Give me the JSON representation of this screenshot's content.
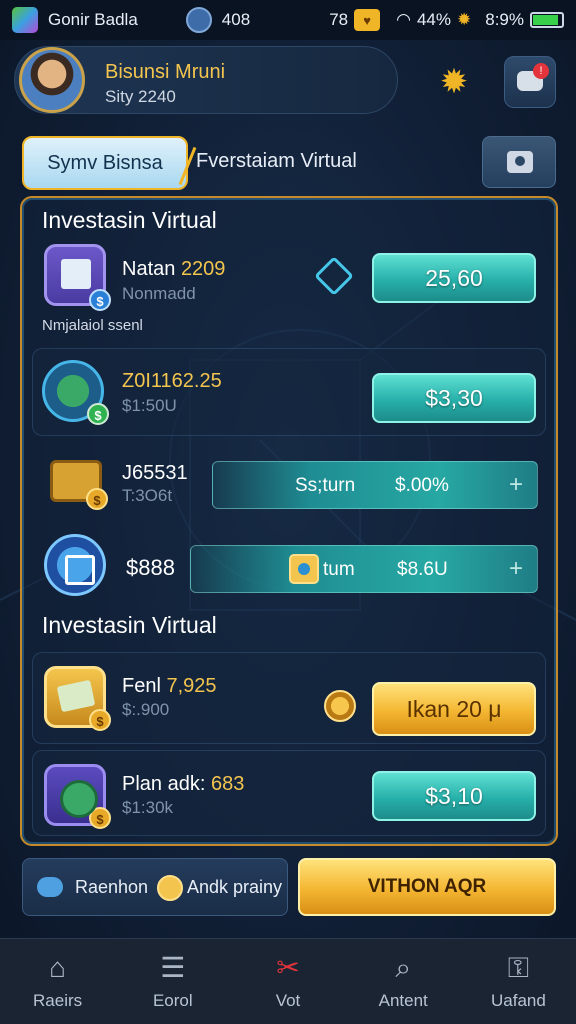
{
  "status_bar": {
    "app_name": "Gonir Badla",
    "counter": "408",
    "coins": "78",
    "wifi_battery": "44%",
    "battery_percent": "8:9%",
    "battery_level": 0.9
  },
  "profile": {
    "name": "Bisunsi Mruni",
    "city_line": "Sity 2240"
  },
  "tabs": {
    "active": "Symv Bisnsa",
    "second": "Fverstaiam Virtual"
  },
  "section1": {
    "title": "Investasin Virtual",
    "rows": [
      {
        "title_prefix": "Natan ",
        "title_value": "2209",
        "subtitle": "Nonmadd",
        "caption": "Nmjalaiol ssenl",
        "button": "25,60"
      },
      {
        "title_prefix": "",
        "title_value": "Z0I1162.25",
        "subtitle": "$1:50U",
        "button": "$3,30"
      },
      {
        "title": "J65531",
        "subtitle": "T:3O6t",
        "bar_left": "Ss;turn",
        "bar_right": "$.00%",
        "bar_plus": "+"
      },
      {
        "title": "$888",
        "bar_left": "tum",
        "bar_right": "$8.6U",
        "bar_plus": "+"
      }
    ]
  },
  "section2": {
    "title": "Investasin Virtual",
    "rows": [
      {
        "title_prefix": "Fenl ",
        "title_value": "7,925",
        "subtitle": "$:.900",
        "button": "Ikan 20 μ"
      },
      {
        "title_prefix": "Plan adk: ",
        "title_value": "683",
        "subtitle": "$1:30k",
        "button": "$3,10"
      }
    ]
  },
  "actions": {
    "left_label_1": "Raenhon",
    "left_label_2": "Andk prainy",
    "right_label": "VITHON AQR"
  },
  "nav": [
    {
      "label": "Raeirs",
      "icon": "home-icon"
    },
    {
      "label": "Eorol",
      "icon": "list-icon"
    },
    {
      "label": "Vot",
      "icon": "tools-icon"
    },
    {
      "label": "Antent",
      "icon": "search-icon"
    },
    {
      "label": "Uafand",
      "icon": "lock-icon"
    }
  ],
  "colors": {
    "accent_gold": "#f3c44e",
    "teal_button": "#27b0aa",
    "panel_border": "#c68a2a",
    "background": "#12223a"
  }
}
